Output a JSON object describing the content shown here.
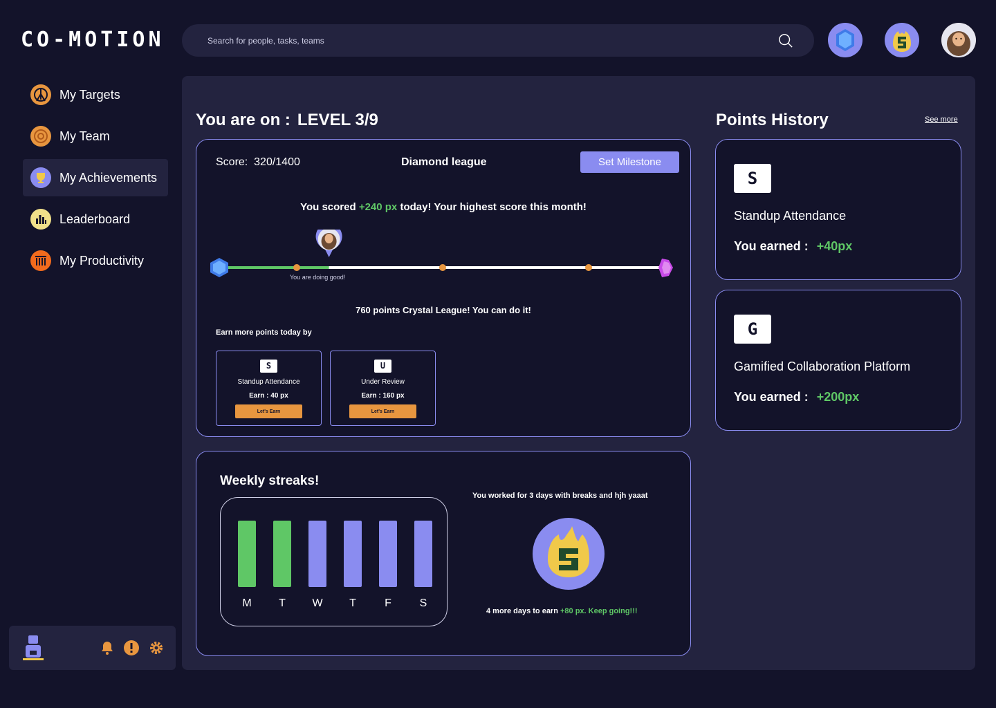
{
  "app": {
    "logo": "CO-MOTION"
  },
  "search": {
    "placeholder": "Search for people, tasks, teams"
  },
  "sidebar": {
    "items": [
      {
        "label": "My Targets",
        "icon": "target-icon",
        "color": "#e8963f"
      },
      {
        "label": "My Team",
        "icon": "team-icon",
        "color": "#e8963f"
      },
      {
        "label": "My Achievements",
        "icon": "trophy-icon",
        "color": "#8a8cf0",
        "active": true
      },
      {
        "label": "Leaderboard",
        "icon": "leaderboard-icon",
        "color": "#f0e08a"
      },
      {
        "label": "My Productivity",
        "icon": "productivity-icon",
        "color": "#f26b1d"
      }
    ]
  },
  "level": {
    "prefix": "You are on :",
    "value": "LEVEL 3/9",
    "score_label": "Score:",
    "score_value": "320/1400",
    "league": "Diamond league",
    "milestone_button": "Set Milestone",
    "scored_prefix": "You scored ",
    "scored_points": "+240 px",
    "scored_suffix": " today! Your highest score this month!",
    "progress_caption": "You are doing good!",
    "progress_fraction": 0.24,
    "crystal_message": "760 points Crystal League! You can do it!",
    "earn_more_title": "Earn more points today by",
    "tasks": [
      {
        "tile": "S",
        "name": "Standup Attendance",
        "earn": "Earn : 40 px",
        "button": "Let's Earn"
      },
      {
        "tile": "U",
        "name": "Under Review",
        "earn": "Earn : 160 px",
        "button": "Let's Earn"
      }
    ]
  },
  "streaks": {
    "title": "Weekly streaks!",
    "days": [
      {
        "label": "M",
        "done": true
      },
      {
        "label": "T",
        "done": true
      },
      {
        "label": "W",
        "done": false
      },
      {
        "label": "T",
        "done": false
      },
      {
        "label": "F",
        "done": false
      },
      {
        "label": "S",
        "done": false
      }
    ],
    "worked_message": "You worked for 3 days with breaks and hjh yaaat",
    "more_prefix": "4 more days to earn ",
    "more_highlight": "+80 px. Keep going!!!"
  },
  "points_history": {
    "title": "Points History",
    "see_more": "See more",
    "items": [
      {
        "tile": "S",
        "name": "Standup Attendance",
        "earned_label": "You earned :",
        "earned_value": "+40px"
      },
      {
        "tile": "G",
        "name": "Gamified Collaboration Platform",
        "earned_label": "You earned :",
        "earned_value": "+200px"
      }
    ]
  },
  "colors": {
    "background": "#13132a",
    "panel": "#23233f",
    "accent": "#8a8cf0",
    "success": "#5fc766",
    "orange": "#e8963f"
  }
}
